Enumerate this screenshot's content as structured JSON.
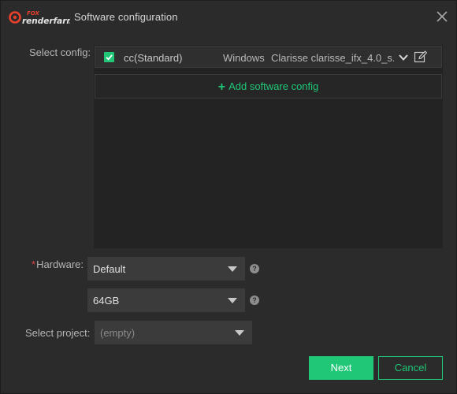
{
  "window": {
    "title": "Software configuration",
    "logo_text": "renderfarm",
    "logo_sub": "FOX"
  },
  "form": {
    "select_config_label": "Select config:",
    "hardware_required_mark": "*",
    "hardware_label": "Hardware:",
    "select_project_label": "Select project:"
  },
  "config": {
    "items": [
      {
        "checked": true,
        "name": "cc(Standard)",
        "os": "Windows",
        "software": "Clarisse clarisse_ifx_4.0_s..."
      }
    ],
    "add_label": "Add software config"
  },
  "hardware": {
    "type_value": "Default",
    "memory_value": "64GB",
    "help_glyph": "?"
  },
  "project": {
    "value": "(empty)"
  },
  "buttons": {
    "next": "Next",
    "cancel": "Cancel"
  },
  "colors": {
    "accent": "#1fc777",
    "background": "#2b2b2b",
    "panel": "#232323",
    "required": "#e04040"
  },
  "icons": {
    "close": "close-icon",
    "checkbox": "check-icon",
    "dropdown": "chevron-down-icon",
    "edit": "edit-icon",
    "add": "plus-icon",
    "help": "question-circle-icon"
  }
}
